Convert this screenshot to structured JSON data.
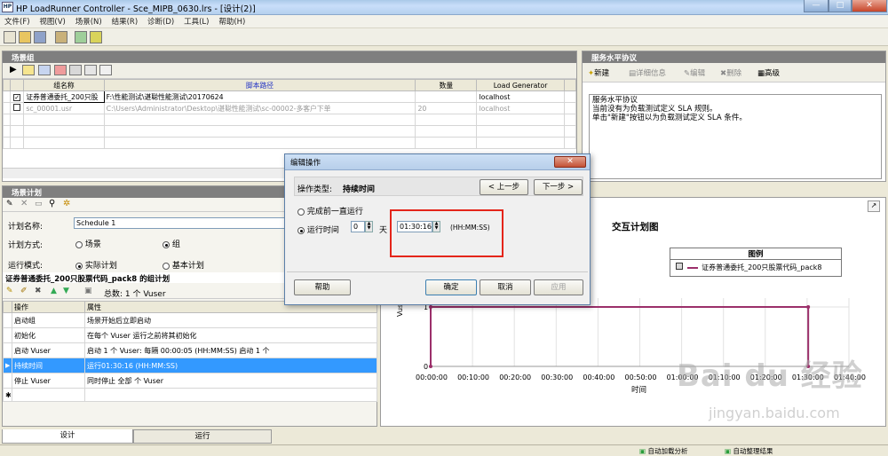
{
  "window": {
    "title": "HP LoadRunner Controller - Sce_MIPB_0630.lrs - [设计(2)]",
    "icon_label": "HP",
    "minimize": "—",
    "maximize": "□",
    "close": "✕"
  },
  "menu": [
    "文件(F)",
    "视图(V)",
    "场景(N)",
    "结果(R)",
    "诊断(D)",
    "工具(L)",
    "帮助(H)"
  ],
  "scenario_groups": {
    "header": "场景组",
    "columns": [
      "组名称",
      "脚本路径",
      "数量",
      "Load Generator"
    ],
    "rows": [
      {
        "checked": true,
        "check_mark": "✓",
        "name": "证券普通委托_200只股",
        "path": "F:\\性能测试\\谌聪性能测试\\20170624",
        "count": "",
        "generator": "localhost"
      },
      {
        "checked": false,
        "check_mark": "",
        "name": "sc_00001.usr",
        "path": "C:\\Users\\Administrator\\Desktop\\谌聪性能测试\\sc-00002-多客户下单",
        "count": "20",
        "generator": "localhost"
      }
    ]
  },
  "sla": {
    "header": "服务水平协议",
    "buttons": [
      "新建",
      "详细信息",
      "编辑",
      "删除",
      "高级"
    ],
    "box_title": "服务水平协议",
    "line1": "当前没有为负载测试定义 SLA 规则。",
    "line2": "单击\"新建\"按钮以为负载测试定义 SLA 条件。"
  },
  "schedule": {
    "header": "场景计划",
    "name_label": "计划名称:",
    "name_value": "Schedule 1",
    "mode_label": "计划方式:",
    "mode_options": [
      "场景",
      "组"
    ],
    "run_label": "运行模式:",
    "run_options": [
      "实际计划",
      "基本计划"
    ],
    "group_title": "证券普通委托_200只股票代码_pack8 的组计划",
    "total": "总数: 1 个 Vuser",
    "columns": [
      "操作",
      "属性"
    ],
    "actions": [
      {
        "op": "启动组",
        "prop": "场景开始后立即启动",
        "selected": false
      },
      {
        "op": "初始化",
        "prop": "在每个 Vuser 运行之前将其初始化",
        "selected": false
      },
      {
        "op": "启动 Vuser",
        "prop": "启动 1 个 Vuser: 每隔 00:00:05 (HH:MM:SS) 启动 1 个",
        "selected": false
      },
      {
        "op": "持续时间",
        "prop": "运行01:30:16 (HH:MM:SS)",
        "selected": true
      },
      {
        "op": "停止 Vuser",
        "prop": "同时停止 全部 个 Vuser",
        "selected": false
      }
    ],
    "new_row_mark": "✱"
  },
  "chart": {
    "title": "交互计划图",
    "legend_title": "图例",
    "legend_entry": "证券普通委托_200只股票代码_pack8",
    "ylabel": "Vuser",
    "xlabel": "时间",
    "line_color": "#9b2f6a",
    "ticks": [
      "00:00:00",
      "00:10:00",
      "00:20:00",
      "00:30:00",
      "00:40:00",
      "00:50:00",
      "01:00:00",
      "01:10:00",
      "01:20:00",
      "01:30:00",
      "01:40:00"
    ],
    "yticks": [
      "0",
      "1"
    ]
  },
  "chart_data": {
    "type": "line",
    "xlabel": "时间",
    "ylabel": "Vuser",
    "title": "交互计划图",
    "x": [
      "00:00:00",
      "00:00:00",
      "01:30:16",
      "01:30:16"
    ],
    "series": [
      {
        "name": "证券普通委托_200只股票代码_pack8",
        "values": [
          0,
          1,
          1,
          0
        ]
      }
    ]
  },
  "dialog": {
    "title": "编辑操作",
    "close": "✕",
    "op_type_label": "操作类型:",
    "op_type_value": "持续时间",
    "prev": "< 上一步",
    "next": "下一步 >",
    "opt_until": "完成前一直运行",
    "opt_run": "运行时间",
    "days_value": "0",
    "days_unit": "天",
    "time_value": "01:30:16",
    "time_format": "(HH:MM:SS)",
    "help": "帮助",
    "ok": "确定",
    "cancel": "取消",
    "apply": "应用"
  },
  "tabs": [
    "设计",
    "运行"
  ],
  "status": [
    "自动加载分析",
    "自动整理结果"
  ],
  "watermark": "Bai du 经验",
  "watermark_url": "jingyan.baidu.com"
}
